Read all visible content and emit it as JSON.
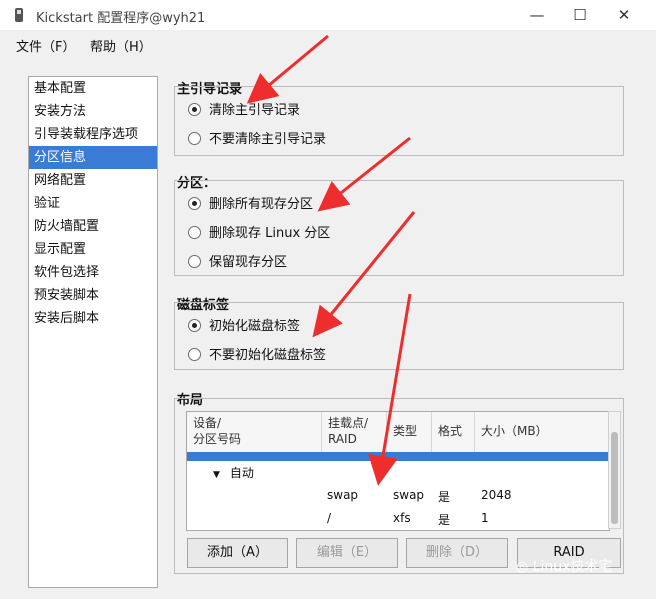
{
  "window": {
    "title": "Kickstart 配置程序@wyh21",
    "minimize": "—",
    "maximize": "☐",
    "close": "✕"
  },
  "menu": {
    "file": "文件（F）",
    "help": "帮助（H）"
  },
  "nav": {
    "items": [
      "基本配置",
      "安装方法",
      "引导装载程序选项",
      "分区信息",
      "网络配置",
      "验证",
      "防火墙配置",
      "显示配置",
      "软件包选择",
      "预安装脚本",
      "安装后脚本"
    ],
    "selected_index": 3
  },
  "mbr": {
    "title": "主引导记录",
    "opt1": "清除主引导记录",
    "opt2": "不要清除主引导记录"
  },
  "partition": {
    "title": "分区：",
    "opt1": "删除所有现存分区",
    "opt2": "删除现存 Linux 分区",
    "opt3": "保留现存分区"
  },
  "disklabel": {
    "title": "磁盘标签",
    "opt1": "初始化磁盘标签",
    "opt2": "不要初始化磁盘标签"
  },
  "layout": {
    "title": "布局",
    "headers": {
      "device": "设备/\n分区号码",
      "mount": "挂载点/\nRAID",
      "type": "类型",
      "format": "格式",
      "size": "大小（MB）"
    },
    "auto_label": "自动",
    "rows": [
      {
        "mount": "swap",
        "type": "swap",
        "format": "是",
        "size": "2048"
      },
      {
        "mount": "/",
        "type": "xfs",
        "format": "是",
        "size": "1"
      }
    ]
  },
  "buttons": {
    "add": "添加（A）",
    "edit": "编辑（E）",
    "delete": "删除（D）",
    "raid": "RAID"
  },
  "watermark": "Linux技术宅",
  "colors": {
    "selection": "#3a7bd5",
    "arrow": "#ee2d2d"
  }
}
